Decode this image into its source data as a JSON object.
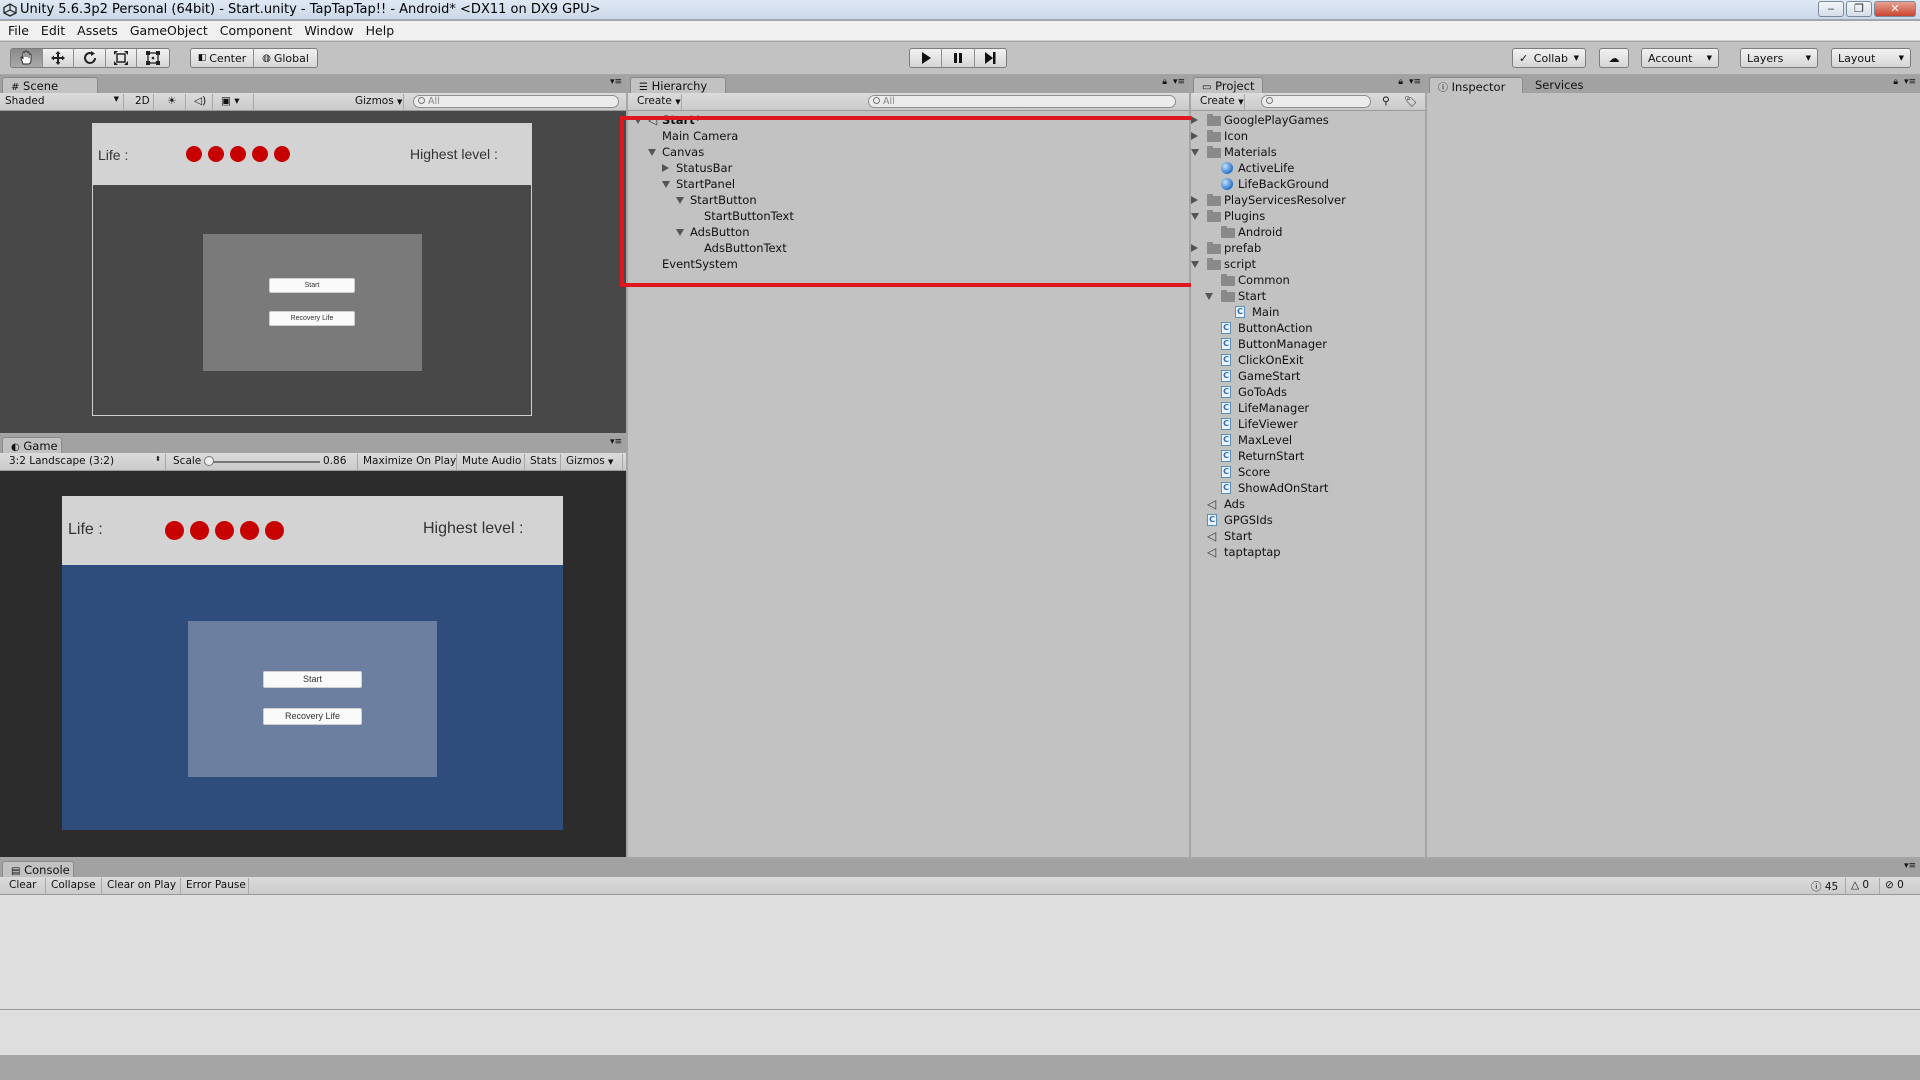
{
  "window": {
    "title": "Unity 5.6.3p2 Personal (64bit) - Start.unity - TapTapTap!! - Android* <DX11 on DX9 GPU>",
    "controls": [
      "‒",
      "❐",
      "✕"
    ]
  },
  "menu": [
    "File",
    "Edit",
    "Assets",
    "GameObject",
    "Component",
    "Window",
    "Help"
  ],
  "toolbar": {
    "tools": [
      "hand-tool",
      "move-tool",
      "rotate-tool",
      "scale-tool",
      "rect-tool"
    ],
    "pivot": "Center",
    "space": "Global",
    "collab": "Collab",
    "account": "Account",
    "layers": "Layers",
    "layout": "Layout"
  },
  "scene": {
    "tab": "Scene",
    "shading": "Shaded",
    "mode_2d": "2D",
    "gizmos": "Gizmos",
    "search_placeholder": "All",
    "life_label": "Life :",
    "highest_label": "Highest level :",
    "start_button": "Start",
    "recovery_button": "Recovery Life",
    "life_count": 5
  },
  "game": {
    "tab": "Game",
    "aspect": "3:2 Landscape (3:2)",
    "scale_label": "Scale",
    "scale_value": "0.86",
    "maximize": "Maximize On Play",
    "mute": "Mute Audio",
    "stats": "Stats",
    "gizmos": "Gizmos",
    "life_label": "Life :",
    "highest_label": "Highest level :",
    "start_button": "Start",
    "recovery_button": "Recovery Life",
    "life_count": 5,
    "bg_color": "#2f4d7c"
  },
  "hierarchy": {
    "tab": "Hierarchy",
    "create": "Create",
    "search_placeholder": "All",
    "items": [
      {
        "label": "Start*",
        "expander": "down",
        "icon": "unity-icon"
      },
      {
        "label": "Main Camera",
        "expander": ""
      },
      {
        "label": "Canvas",
        "expander": "down"
      },
      {
        "label": "StatusBar",
        "expander": "right"
      },
      {
        "label": "StartPanel",
        "expander": "down"
      },
      {
        "label": "StartButton",
        "expander": "down"
      },
      {
        "label": "StartButtonText",
        "expander": ""
      },
      {
        "label": "AdsButton",
        "expander": "down"
      },
      {
        "label": "AdsButtonText",
        "expander": ""
      },
      {
        "label": "EventSystem",
        "expander": ""
      }
    ],
    "highlight_color": "#e0161e"
  },
  "project": {
    "tab": "Project",
    "create": "Create",
    "items": [
      {
        "label": "GooglePlayGames",
        "icon": "folder",
        "expander": "right"
      },
      {
        "label": "Icon",
        "icon": "folder",
        "expander": "right"
      },
      {
        "label": "Materials",
        "icon": "folder",
        "expander": "down"
      },
      {
        "label": "ActiveLife",
        "icon": "material"
      },
      {
        "label": "LifeBackGround",
        "icon": "material"
      },
      {
        "label": "PlayServicesResolver",
        "icon": "folder",
        "expander": "right"
      },
      {
        "label": "Plugins",
        "icon": "folder",
        "expander": "down"
      },
      {
        "label": "Android",
        "icon": "folder"
      },
      {
        "label": "prefab",
        "icon": "folder",
        "expander": "right"
      },
      {
        "label": "script",
        "icon": "folder",
        "expander": "down"
      },
      {
        "label": "Common",
        "icon": "folder"
      },
      {
        "label": "Start",
        "icon": "folder",
        "expander": "down"
      },
      {
        "label": "Main",
        "icon": "script"
      },
      {
        "label": "ButtonAction",
        "icon": "script"
      },
      {
        "label": "ButtonManager",
        "icon": "script"
      },
      {
        "label": "ClickOnExit",
        "icon": "script"
      },
      {
        "label": "GameStart",
        "icon": "script"
      },
      {
        "label": "GoToAds",
        "icon": "script"
      },
      {
        "label": "LifeManager",
        "icon": "script"
      },
      {
        "label": "LifeViewer",
        "icon": "script"
      },
      {
        "label": "MaxLevel",
        "icon": "script"
      },
      {
        "label": "ReturnStart",
        "icon": "script"
      },
      {
        "label": "Score",
        "icon": "script"
      },
      {
        "label": "ShowAdOnStart",
        "icon": "script"
      },
      {
        "label": "Ads",
        "icon": "unity-scene"
      },
      {
        "label": "GPGSIds",
        "icon": "script"
      },
      {
        "label": "Start",
        "icon": "unity-scene"
      },
      {
        "label": "taptaptap",
        "icon": "unity-scene"
      }
    ]
  },
  "inspector": {
    "tab": "Inspector",
    "services_tab": "Services"
  },
  "console": {
    "tab": "Console",
    "buttons": [
      "Clear",
      "Collapse",
      "Clear on Play",
      "Error Pause"
    ],
    "log_count": "45",
    "warn_count": "0",
    "error_count": "0"
  }
}
